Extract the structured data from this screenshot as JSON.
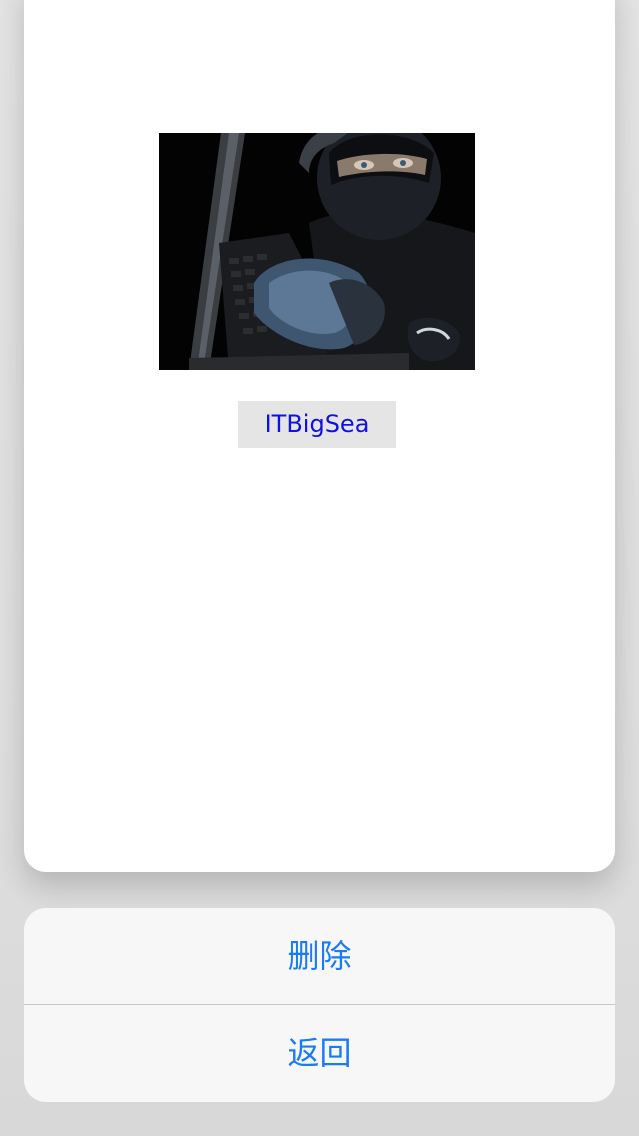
{
  "card": {
    "photo_subject": "hacker-photo",
    "name_label": "ITBigSea"
  },
  "actions": {
    "delete_label": "删除",
    "back_label": "返回"
  },
  "colors": {
    "accent": "#1a7cf0",
    "name_text": "#1010e0",
    "label_bg": "#e5e5e5",
    "sheet_bg": "#f7f7f7"
  }
}
